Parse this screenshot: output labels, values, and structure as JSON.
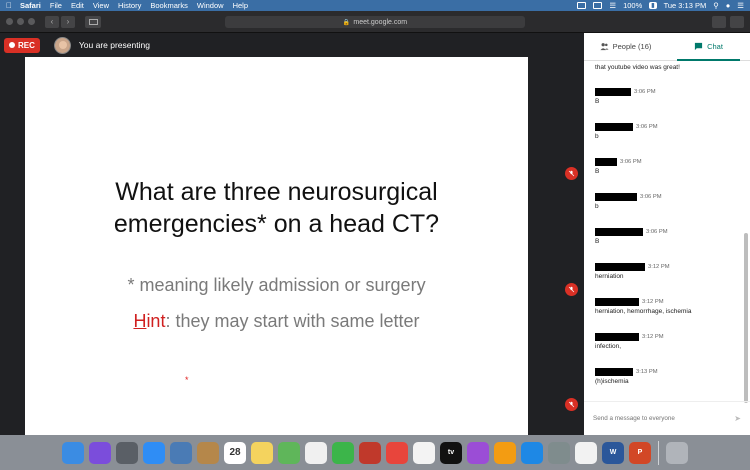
{
  "menubar": {
    "app": "Safari",
    "items": [
      "File",
      "Edit",
      "View",
      "History",
      "Bookmarks",
      "Window",
      "Help"
    ],
    "battery": "100%",
    "clock": "Tue 3:13 PM"
  },
  "browser": {
    "url": "meet.google.com"
  },
  "meeting": {
    "rec_label": "REC",
    "presenting_label": "You are presenting"
  },
  "slide": {
    "question_line1": "What are three neurosurgical",
    "question_line2": "emergencies* on a head CT?",
    "footnote": "* meaning likely admission or surgery",
    "hint_h": "H",
    "hint_int": "int",
    "hint_rest": ": they may start with same letter",
    "marker": "*"
  },
  "panel": {
    "tabs": [
      {
        "label": "People (16)",
        "icon": "people-icon"
      },
      {
        "label": "Chat",
        "icon": "chat-icon"
      }
    ],
    "first_message": "that youtube video was great!",
    "messages": [
      {
        "time": "3:06 PM",
        "text": "B"
      },
      {
        "time": "3:06 PM",
        "text": "b"
      },
      {
        "time": "3:06 PM",
        "text": "B"
      },
      {
        "time": "3:06 PM",
        "text": "b"
      },
      {
        "time": "3:06 PM",
        "text": "B"
      },
      {
        "time": "3:12 PM",
        "text": "herniation"
      },
      {
        "time": "3:12 PM",
        "text": "herniation, hemorrhage, ischemia"
      },
      {
        "time": "3:12 PM",
        "text": "infection,"
      },
      {
        "time": "3:13 PM",
        "text": "(h)ischemia"
      }
    ],
    "composer_placeholder": "Send a message to everyone",
    "accent_color": "#00796b"
  },
  "dock": {
    "apps": [
      {
        "name": "finder",
        "color": "#3b8ce3"
      },
      {
        "name": "siri",
        "color": "#7b4ddb"
      },
      {
        "name": "launchpad",
        "color": "#5a5f66"
      },
      {
        "name": "safari",
        "color": "#2f8df5"
      },
      {
        "name": "preview",
        "color": "#4a7bb5"
      },
      {
        "name": "contacts",
        "color": "#b5874a"
      },
      {
        "name": "calendar",
        "color": "#ffffff",
        "text": "28"
      },
      {
        "name": "notes",
        "color": "#f4d35e"
      },
      {
        "name": "maps",
        "color": "#5fb65a"
      },
      {
        "name": "photos",
        "color": "#f0f0f0"
      },
      {
        "name": "facetime",
        "color": "#3cb54a"
      },
      {
        "name": "photo-booth",
        "color": "#c0392b"
      },
      {
        "name": "news",
        "color": "#e8453c"
      },
      {
        "name": "music",
        "color": "#f3f3f3"
      },
      {
        "name": "tv",
        "color": "#111111",
        "text": "tv"
      },
      {
        "name": "podcasts",
        "color": "#9b4dd6"
      },
      {
        "name": "books",
        "color": "#f39c12"
      },
      {
        "name": "app-store",
        "color": "#1e88e5"
      },
      {
        "name": "system-preferences",
        "color": "#7f8c8d"
      },
      {
        "name": "chrome",
        "color": "#f2f2f2"
      },
      {
        "name": "word",
        "color": "#2b579a",
        "text": "W"
      },
      {
        "name": "powerpoint",
        "color": "#d24726",
        "text": "P"
      },
      {
        "name": "trash",
        "color": "#b0b4ba"
      }
    ]
  }
}
